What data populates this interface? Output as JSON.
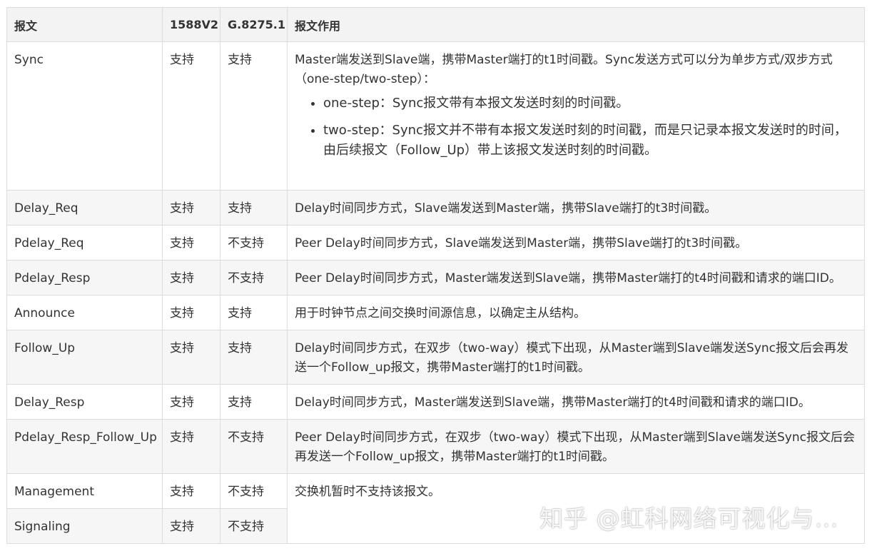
{
  "headers": [
    "报文",
    "1588V2",
    "G.8275.1",
    "报文作用"
  ],
  "rows": [
    {
      "msg": "Sync",
      "v1588": "支持",
      "g8275": "支持",
      "desc": "Master端发送到Slave端，携带Master端打的t1时间戳。Sync发送方式可以分为单步方式/双步方式（one-step/two-step）：",
      "bullets": [
        "one-step：Sync报文带有本报文发送时刻的时间戳。",
        "two-step：Sync报文并不带有本报文发送时刻的时间戳，而是只记录本报文发送时的时间，由后续报文（Follow_Up）带上该报文发送时刻的时间戳。"
      ]
    },
    {
      "msg": "Delay_Req",
      "v1588": "支持",
      "g8275": "支持",
      "desc": "Delay时间同步方式，Slave端发送到Master端，携带Slave端打的t3时间戳。"
    },
    {
      "msg": "Pdelay_Req",
      "v1588": "支持",
      "g8275": "不支持",
      "desc": "Peer Delay时间同步方式，Slave端发送到Master端，携带Slave端打的t3时间戳。"
    },
    {
      "msg": "Pdelay_Resp",
      "v1588": "支持",
      "g8275": "不支持",
      "desc": "Peer Delay时间同步方式，Master端发送到Slave端，携带Master端打的t4时间戳和请求的端口ID。"
    },
    {
      "msg": "Announce",
      "v1588": "支持",
      "g8275": "支持",
      "desc": "用于时钟节点之间交换时间源信息，以确定主从结构。"
    },
    {
      "msg": "Follow_Up",
      "v1588": "支持",
      "g8275": "支持",
      "desc": "Delay时间同步方式，在双步（two-way）模式下出现，从Master端到Slave端发送Sync报文后会再发送一个Follow_up报文，携带Master端打的t1时间戳。"
    },
    {
      "msg": "Delay_Resp",
      "v1588": "支持",
      "g8275": "支持",
      "desc": "Delay时间同步方式，Master端发送到Slave端，携带Master端打的t4时间戳和请求的端口ID。"
    },
    {
      "msg": "Pdelay_Resp_Follow_Up",
      "v1588": "支持",
      "g8275": "不支持",
      "desc": "Peer Delay时间同步方式，在双步（two-way）模式下出现，从Master端到Slave端发送Sync报文后会再发送一个Follow_up报文，携带Master端打的t1时间戳。"
    },
    {
      "msg": "Management",
      "v1588": "支持",
      "g8275": "不支持",
      "desc": "交换机暂时不支持该报文。"
    },
    {
      "msg": "Signaling",
      "v1588": "支持",
      "g8275": "不支持"
    }
  ],
  "watermark": "知乎 @虹科网络可视化与…",
  "colors": {
    "header_bg": "#f3f3f3",
    "border": "#dcdcdc",
    "shade_bg": "#f6f6f6",
    "text": "#333333"
  }
}
